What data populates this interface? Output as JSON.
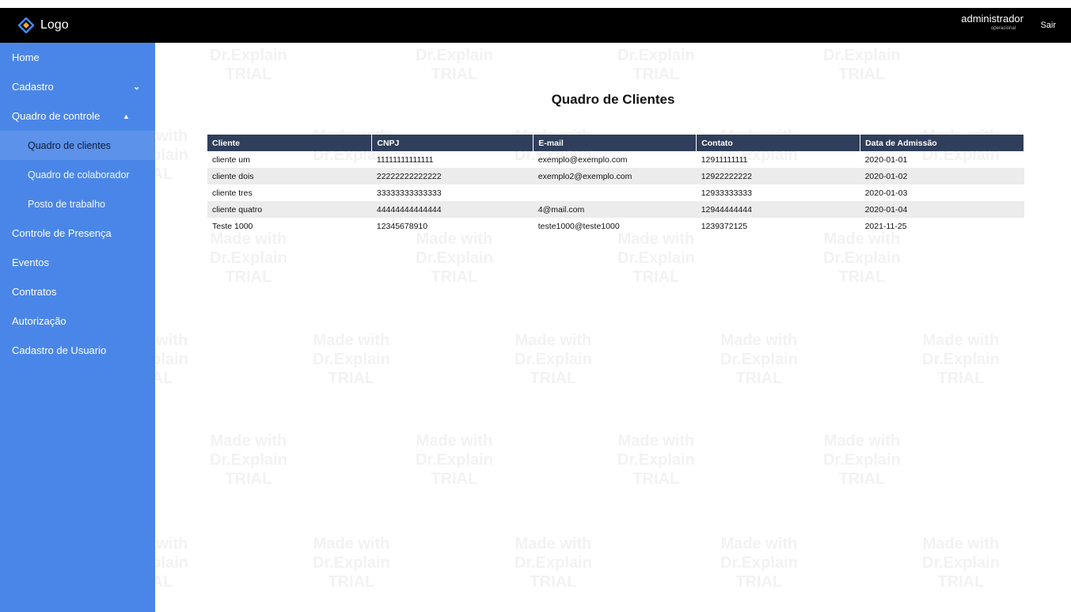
{
  "header": {
    "logo_text": "Logo",
    "user_name": "administrador",
    "user_role": "operacional",
    "logout_label": "Sair"
  },
  "sidebar": {
    "items": [
      {
        "label": "Home"
      },
      {
        "label": "Cadastro"
      },
      {
        "label": "Quadro de controle"
      },
      {
        "label": "Quadro de clientes"
      },
      {
        "label": "Quadro de colaborador"
      },
      {
        "label": "Posto de trabalho"
      },
      {
        "label": "Controle de Presença"
      },
      {
        "label": "Eventos"
      },
      {
        "label": "Contratos"
      },
      {
        "label": "Autorização"
      },
      {
        "label": "Cadastro de Usuario"
      }
    ]
  },
  "main": {
    "title": "Quadro de Clientes",
    "table": {
      "headers": [
        "Cliente",
        "CNPJ",
        "E-mail",
        "Contato",
        "Data de Admissão"
      ],
      "rows": [
        [
          "cliente um",
          "11111111111111",
          "exemplo@exemplo.com",
          "12911111111",
          "2020-01-01"
        ],
        [
          "cliente dois",
          "22222222222222",
          "exemplo2@exemplo.com",
          "12922222222",
          "2020-01-02"
        ],
        [
          "cliente tres",
          "33333333333333",
          "",
          "12933333333",
          "2020-01-03"
        ],
        [
          "cliente quatro",
          "44444444444444",
          "4@mail.com",
          "12944444444",
          "2020-01-04"
        ],
        [
          "Teste 1000",
          "12345678910",
          "teste1000@teste1000",
          "1239372125",
          "2021-11-25"
        ]
      ]
    }
  },
  "watermark": {
    "line1": "Made with",
    "line2": "Dr.Explain",
    "line3": "TRIAL"
  },
  "colors": {
    "sidebar": "#4a86e8",
    "topbar": "#000000",
    "table_header": "#2f3e5a",
    "logo_icon": "#3d8bfd"
  }
}
